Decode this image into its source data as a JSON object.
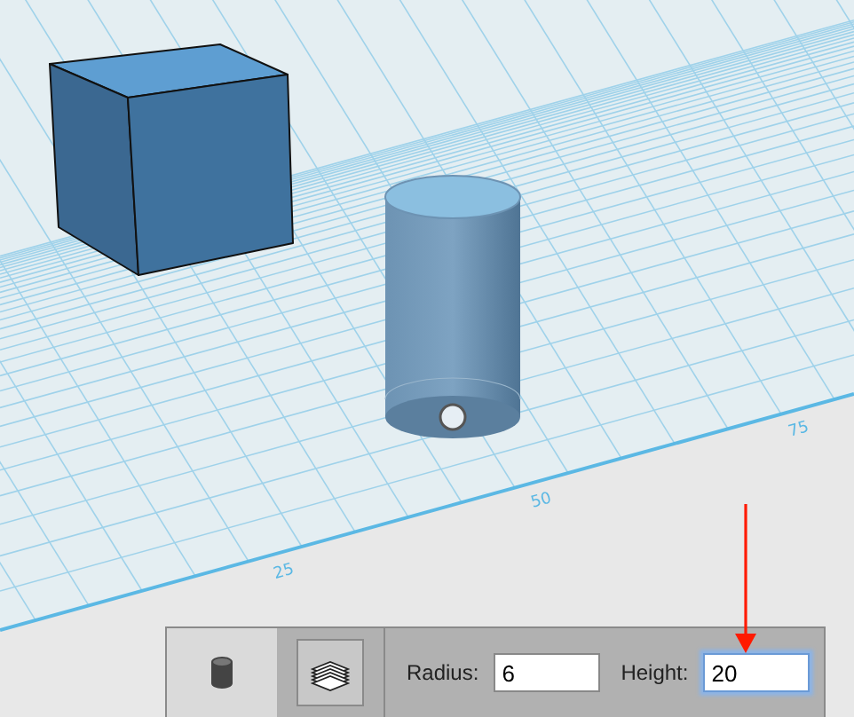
{
  "scene": {
    "axis_labels": [
      {
        "text": "25"
      },
      {
        "text": "50"
      },
      {
        "text": "75"
      }
    ]
  },
  "toolbar": {
    "tools": [
      {
        "kind": "primitive",
        "selected": true
      },
      {
        "kind": "layers",
        "selected": false
      }
    ],
    "fields": [
      {
        "label": "Radius:",
        "value": "6",
        "focused": false
      },
      {
        "label": "Height:",
        "value": "20",
        "focused": true
      }
    ]
  }
}
